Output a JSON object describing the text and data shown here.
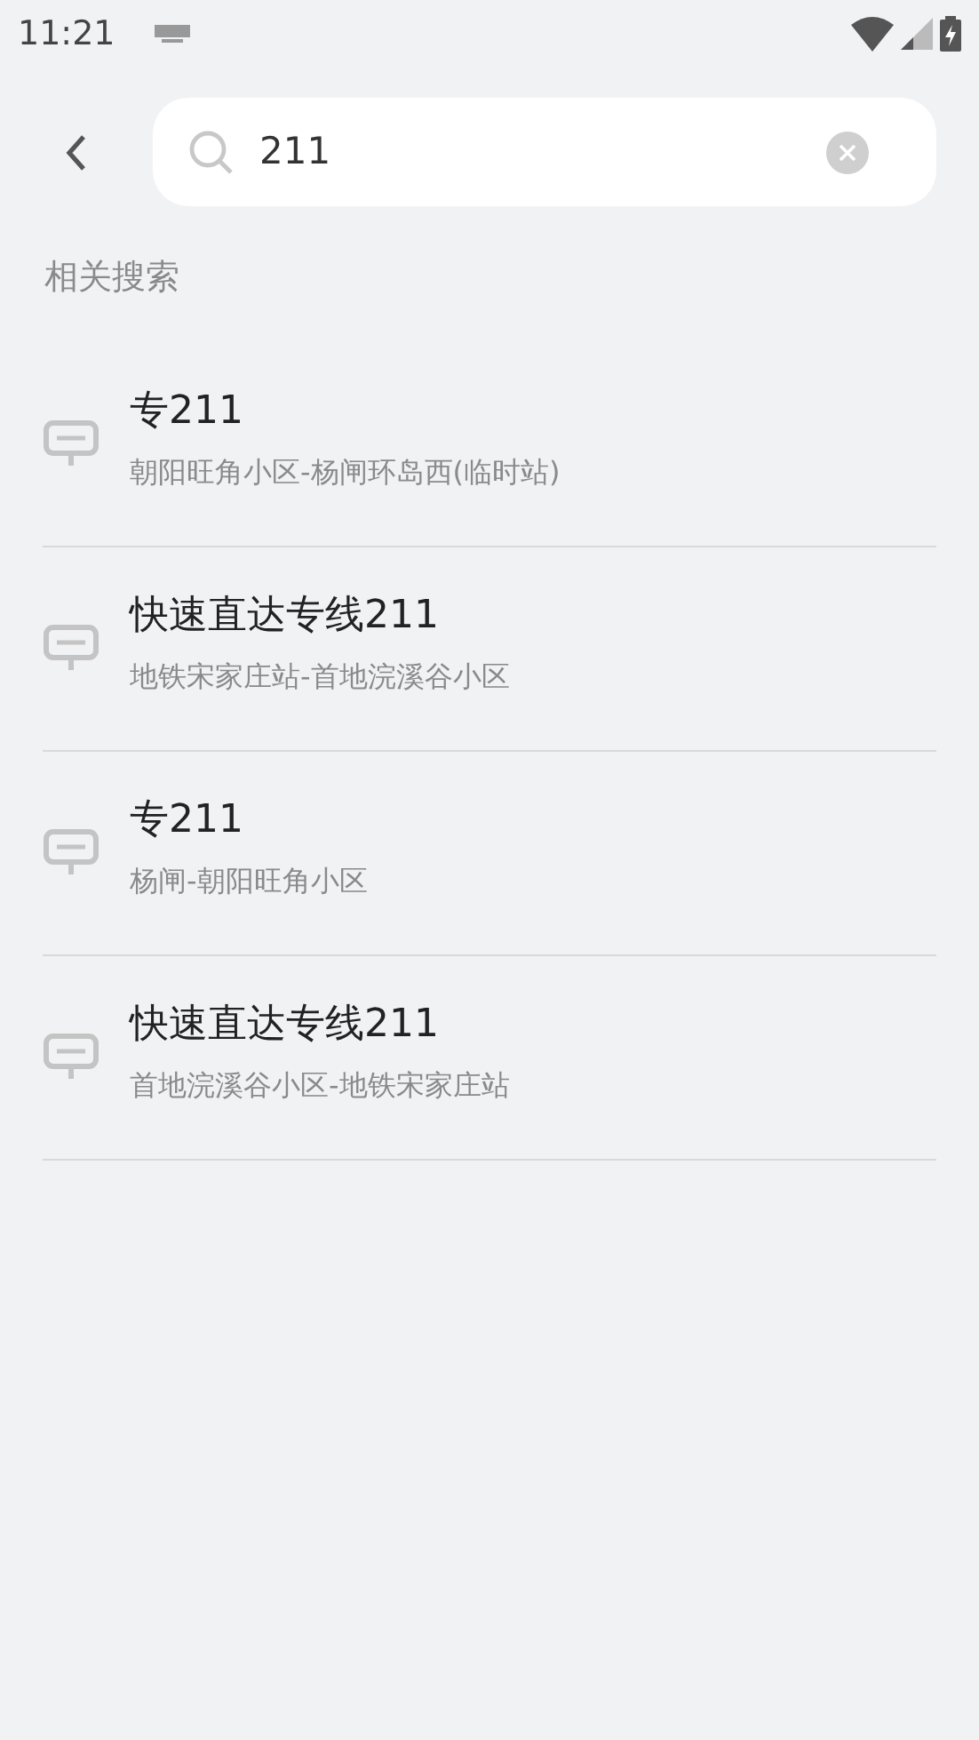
{
  "status_bar": {
    "time": "11:21"
  },
  "search": {
    "value": "211"
  },
  "section_title": "相关搜索",
  "results": [
    {
      "name": "专211",
      "route": "朝阳旺角小区-杨闸环岛西(临时站)"
    },
    {
      "name": "快速直达专线211",
      "route": "地铁宋家庄站-首地浣溪谷小区"
    },
    {
      "name": "专211",
      "route": "杨闸-朝阳旺角小区"
    },
    {
      "name": "快速直达专线211",
      "route": "首地浣溪谷小区-地铁宋家庄站"
    }
  ]
}
